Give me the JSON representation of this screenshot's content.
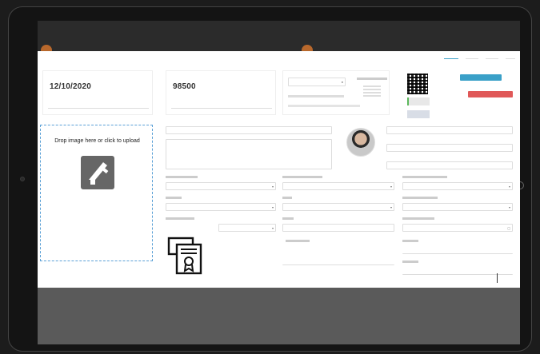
{
  "breadcrumb": "",
  "tabs": [
    {
      "label": ""
    },
    {
      "label": ""
    },
    {
      "label": ""
    },
    {
      "label": ""
    }
  ],
  "stats": [
    {
      "value": "12/10/2020",
      "caption": ""
    },
    {
      "value": "98500",
      "caption": ""
    }
  ],
  "dropzone": {
    "text": "Drop image here or click to upload"
  },
  "buttons": {
    "primary": "",
    "danger": ""
  },
  "fields": {
    "name": "",
    "notes": "",
    "category": "",
    "location": "",
    "type": "",
    "unit": ""
  },
  "colors": {
    "accent": "#3aa0c8",
    "danger": "#e05858",
    "success": "#5cb85c",
    "screen_bg": "#2e2e2e"
  },
  "icons": [
    "caliper-icon",
    "certificate-icon",
    "qr-code-icon",
    "avatar"
  ]
}
